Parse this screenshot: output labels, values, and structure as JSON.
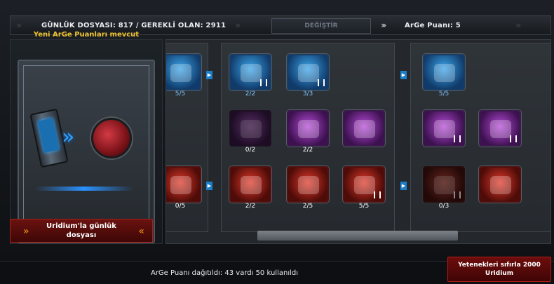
{
  "header": {
    "daily_text": "GÜNLÜK DOSYASI: 817 / GEREKLİ OLAN: 2911",
    "change_button": "DEĞİŞTİR",
    "points_text": "ArGe Puanı: 5",
    "chevron": "›››"
  },
  "left_panel": {
    "new_points_text": "Yeni ArGe Puanları mevcut",
    "uridium_button": "Uridium'la günlük dosyası",
    "chevron_left": "»",
    "chevron_right": "«",
    "arrow": "»"
  },
  "skills": [
    {
      "count": "5/5",
      "theme": "blue",
      "locked": false,
      "icon": "radar-icon"
    },
    {
      "count": "2/2",
      "theme": "blue",
      "locked": false,
      "icon": "ship-icon"
    },
    {
      "count": "3/3",
      "theme": "blue",
      "locked": false,
      "icon": "cargo-icon"
    },
    {
      "count": "5/5",
      "theme": "blue",
      "locked": false,
      "icon": "drone-icon"
    },
    {
      "count": "0/2",
      "theme": "purple",
      "locked": true,
      "icon": "module-icon"
    },
    {
      "count": "2/2",
      "theme": "purple",
      "locked": false,
      "icon": "fist-icon"
    },
    {
      "count": "",
      "theme": "purple",
      "locked": false,
      "icon": "laser-icon"
    },
    {
      "count": "",
      "theme": "purple",
      "locked": false,
      "icon": "hand-icon"
    },
    {
      "count": "",
      "theme": "purple",
      "locked": false,
      "icon": "cube-icon"
    },
    {
      "count": "0/5",
      "theme": "red",
      "locked": false,
      "icon": "pepper-icon"
    },
    {
      "count": "2/2",
      "theme": "red",
      "locked": false,
      "icon": "head-icon"
    },
    {
      "count": "2/5",
      "theme": "red",
      "locked": false,
      "icon": "rocket-launcher-icon"
    },
    {
      "count": "5/5",
      "theme": "red",
      "locked": false,
      "icon": "sword-icon"
    },
    {
      "count": "0/3",
      "theme": "red",
      "locked": true,
      "icon": "skull-icon"
    },
    {
      "count": "",
      "theme": "red",
      "locked": false,
      "icon": "fighter-icon"
    }
  ],
  "footer": {
    "points_summary": "ArGe Puanı dağıtıldı: 43 vardı 50 kullanıldı",
    "reset_button": "Yetenekleri sıfırla 2000 Uridium"
  },
  "colors": {
    "accent_gold": "#f1c531",
    "accent_blue": "#2fa2ff",
    "accent_red": "#b31b15"
  }
}
